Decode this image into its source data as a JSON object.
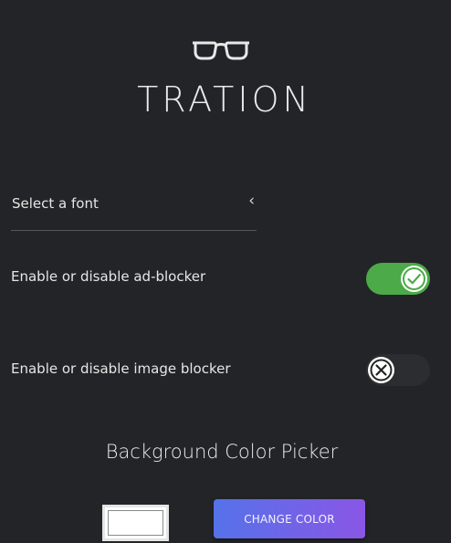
{
  "brand": {
    "logo_icon": "glasses-icon",
    "name": "TRATION"
  },
  "font_select": {
    "label": "Select a font",
    "chevron_glyph": "‹"
  },
  "settings": {
    "ad_blocker": {
      "label": "Enable or disable ad-blocker",
      "enabled": true,
      "icon": "check-icon",
      "color": "#4caa48"
    },
    "image_blocker": {
      "label": "Enable or disable image blocker",
      "enabled": false,
      "icon": "close-icon"
    }
  },
  "color_picker": {
    "title": "Background Color Picker",
    "current_color": "#ffffff",
    "button_label": "CHANGE COLOR",
    "button_gradient": [
      "#5572e9",
      "#8a56e6"
    ]
  }
}
